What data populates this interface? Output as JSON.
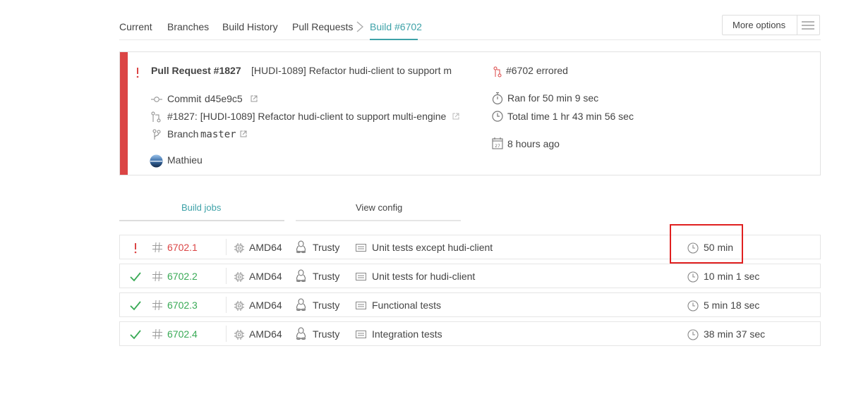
{
  "nav": {
    "items": [
      "Current",
      "Branches",
      "Build History",
      "Pull Requests"
    ],
    "active": "Build #6702",
    "more_options": "More options"
  },
  "build": {
    "title": "Pull Request #1827",
    "subtitle": "[HUDI-1089] Refactor hudi-client to support m",
    "commit_label": "Commit",
    "commit_sha": "d45e9c5",
    "pr_line": "#1827: [HUDI-1089] Refactor hudi-client to support multi-engine",
    "branch_label": "Branch",
    "branch_name": "master",
    "author": "Mathieu",
    "status": "#6702 errored",
    "ran_for": "Ran for 50 min 9 sec",
    "total_time": "Total time 1 hr 43 min 56 sec",
    "when": "8 hours ago",
    "calendar_day": "27"
  },
  "tabs": {
    "build_jobs": "Build jobs",
    "view_config": "View config"
  },
  "jobs": [
    {
      "status": "errored",
      "number": "6702.1",
      "arch": "AMD64",
      "os": "Trusty",
      "name": "Unit tests except hudi-client",
      "duration": "50 min"
    },
    {
      "status": "passed",
      "number": "6702.2",
      "arch": "AMD64",
      "os": "Trusty",
      "name": "Unit tests for hudi-client",
      "duration": "10 min 1 sec"
    },
    {
      "status": "passed",
      "number": "6702.3",
      "arch": "AMD64",
      "os": "Trusty",
      "name": "Functional tests",
      "duration": "5 min 18 sec"
    },
    {
      "status": "passed",
      "number": "6702.4",
      "arch": "AMD64",
      "os": "Trusty",
      "name": "Integration tests",
      "duration": "38 min 37 sec"
    }
  ],
  "colors": {
    "error": "#db4545",
    "success": "#39aa56",
    "accent": "#3ea2a8",
    "highlight": "#e02020"
  }
}
